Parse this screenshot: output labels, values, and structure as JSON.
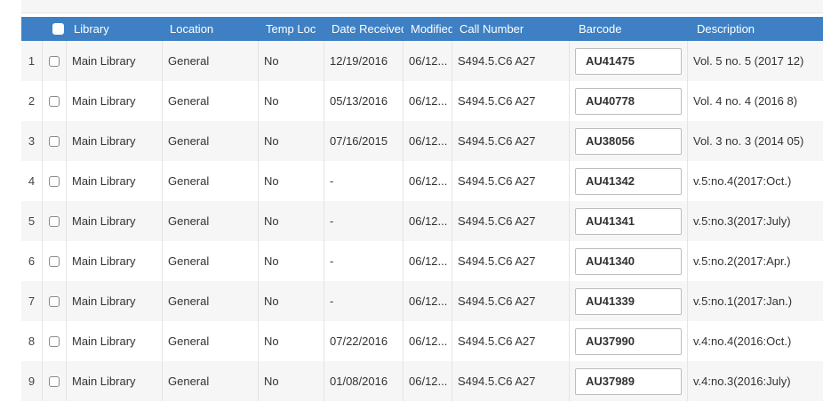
{
  "table": {
    "columns": {
      "library": "Library",
      "location": "Location",
      "temp_loc": "Temp Loc",
      "date_received": "Date Received",
      "modified": "Modified",
      "call_number": "Call Number",
      "barcode": "Barcode",
      "description": "Description"
    },
    "rows": [
      {
        "num": "1",
        "library": "Main Library",
        "location": "General",
        "temp_loc": "No",
        "date_received": "12/19/2016",
        "modified": "06/12...",
        "call_number": "S494.5.C6 A27",
        "barcode": "AU41475",
        "description": "Vol. 5 no. 5 (2017 12)"
      },
      {
        "num": "2",
        "library": "Main Library",
        "location": "General",
        "temp_loc": "No",
        "date_received": "05/13/2016",
        "modified": "06/12...",
        "call_number": "S494.5.C6 A27",
        "barcode": "AU40778",
        "description": "Vol. 4 no. 4 (2016 8)"
      },
      {
        "num": "3",
        "library": "Main Library",
        "location": "General",
        "temp_loc": "No",
        "date_received": "07/16/2015",
        "modified": "06/12...",
        "call_number": "S494.5.C6 A27",
        "barcode": "AU38056",
        "description": "Vol. 3 no. 3 (2014 05)"
      },
      {
        "num": "4",
        "library": "Main Library",
        "location": "General",
        "temp_loc": "No",
        "date_received": "-",
        "modified": "06/12...",
        "call_number": "S494.5.C6 A27",
        "barcode": "AU41342",
        "description": "v.5:no.4(2017:Oct.)"
      },
      {
        "num": "5",
        "library": "Main Library",
        "location": "General",
        "temp_loc": "No",
        "date_received": "-",
        "modified": "06/12...",
        "call_number": "S494.5.C6 A27",
        "barcode": "AU41341",
        "description": "v.5:no.3(2017:July)"
      },
      {
        "num": "6",
        "library": "Main Library",
        "location": "General",
        "temp_loc": "No",
        "date_received": "-",
        "modified": "06/12...",
        "call_number": "S494.5.C6 A27",
        "barcode": "AU41340",
        "description": "v.5:no.2(2017:Apr.)"
      },
      {
        "num": "7",
        "library": "Main Library",
        "location": "General",
        "temp_loc": "No",
        "date_received": "-",
        "modified": "06/12...",
        "call_number": "S494.5.C6 A27",
        "barcode": "AU41339",
        "description": "v.5:no.1(2017:Jan.)"
      },
      {
        "num": "8",
        "library": "Main Library",
        "location": "General",
        "temp_loc": "No",
        "date_received": "07/22/2016",
        "modified": "06/12...",
        "call_number": "S494.5.C6 A27",
        "barcode": "AU37990",
        "description": "v.4:no.4(2016:Oct.)"
      },
      {
        "num": "9",
        "library": "Main Library",
        "location": "General",
        "temp_loc": "No",
        "date_received": "01/08/2016",
        "modified": "06/12...",
        "call_number": "S494.5.C6 A27",
        "barcode": "AU37989",
        "description": "v.4:no.3(2016:July)"
      }
    ]
  }
}
